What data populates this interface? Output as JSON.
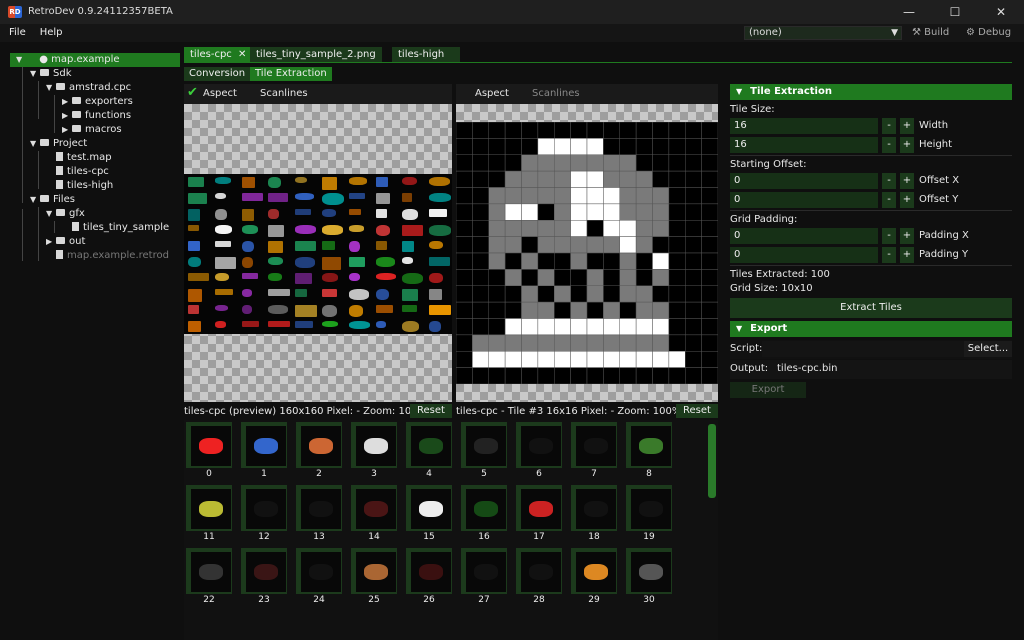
{
  "window": {
    "title": "RetroDev 0.9.24112357BETA",
    "app_icon_text": "RD",
    "minimize_glyph": "—",
    "maximize_glyph": "☐",
    "close_glyph": "✕"
  },
  "menu": {
    "items": [
      "File",
      "Help"
    ]
  },
  "toolbar": {
    "profile_combo_value": "(none)",
    "build_label": "Build",
    "debug_label": "Debug"
  },
  "tree": {
    "root": "map.example",
    "items": [
      {
        "label": "Sdk",
        "depth": 1,
        "type": "folder",
        "expanded": true
      },
      {
        "label": "amstrad.cpc",
        "depth": 2,
        "type": "folder",
        "expanded": true
      },
      {
        "label": "exporters",
        "depth": 3,
        "type": "folder",
        "expanded": false
      },
      {
        "label": "functions",
        "depth": 3,
        "type": "folder",
        "expanded": false
      },
      {
        "label": "macros",
        "depth": 3,
        "type": "folder",
        "expanded": false
      },
      {
        "label": "Project",
        "depth": 1,
        "type": "folder",
        "expanded": true
      },
      {
        "label": "test.map",
        "depth": 2,
        "type": "file"
      },
      {
        "label": "tiles-cpc",
        "depth": 2,
        "type": "file"
      },
      {
        "label": "tiles-high",
        "depth": 2,
        "type": "file"
      },
      {
        "label": "Files",
        "depth": 1,
        "type": "folder",
        "expanded": true
      },
      {
        "label": "gfx",
        "depth": 2,
        "type": "folder",
        "expanded": true
      },
      {
        "label": "tiles_tiny_sample",
        "depth": 3,
        "type": "file"
      },
      {
        "label": "out",
        "depth": 2,
        "type": "folder",
        "expanded": false
      },
      {
        "label": "map.example.retrod",
        "depth": 2,
        "type": "file",
        "dim": true
      }
    ]
  },
  "doc_tabs": [
    {
      "label": "tiles-cpc",
      "active": true,
      "closable": true
    },
    {
      "label": "tiles_tiny_sample_2.png",
      "active": false
    },
    {
      "label": "tiles-high",
      "active": false
    }
  ],
  "sub_tabs": [
    {
      "label": "Conversion",
      "active": false
    },
    {
      "label": "Tile Extraction",
      "active": true
    }
  ],
  "left_view": {
    "aspect_label": "Aspect",
    "aspect_checked": true,
    "scanlines_label": "Scanlines",
    "status": "tiles-cpc (preview)   160x160   Pixel: -   Zoom: 100%",
    "reset_label": "Reset"
  },
  "right_view": {
    "aspect_label": "Aspect",
    "scanlines_label": "Scanlines",
    "status": "tiles-cpc - Tile #3   16x16   Pixel: -   Zoom: 100%",
    "reset_label": "Reset"
  },
  "tile_grid": {
    "labels": [
      "0",
      "1",
      "2",
      "3",
      "4",
      "5",
      "6",
      "7",
      "8",
      "11",
      "12",
      "13",
      "14",
      "15",
      "16",
      "17",
      "18",
      "19",
      "22",
      "23",
      "24",
      "25",
      "26",
      "27",
      "28",
      "29",
      "30"
    ]
  },
  "tile_extraction": {
    "section_title": "Tile Extraction",
    "tile_size_label": "Tile Size:",
    "width_value": "16",
    "width_label": "Width",
    "height_value": "16",
    "height_label": "Height",
    "offset_label": "Starting Offset:",
    "offset_x_value": "0",
    "offset_x_label": "Offset X",
    "offset_y_value": "0",
    "offset_y_label": "Offset Y",
    "padding_label": "Grid Padding:",
    "padding_x_value": "0",
    "padding_x_label": "Padding X",
    "padding_y_value": "0",
    "padding_y_label": "Padding Y",
    "tiles_extracted": "Tiles Extracted: 100",
    "grid_size": "Grid Size: 10x10",
    "extract_button": "Extract Tiles",
    "minus": "-",
    "plus": "+"
  },
  "export": {
    "section_title": "Export",
    "script_label": "Script:",
    "select_button": "Select...",
    "output_label": "Output:",
    "output_value": "tiles-cpc.bin",
    "export_button": "Export"
  },
  "colors": {
    "accent": "#1f7a1f",
    "accent_dark": "#1b3a1b",
    "background": "#0f0f0f"
  }
}
